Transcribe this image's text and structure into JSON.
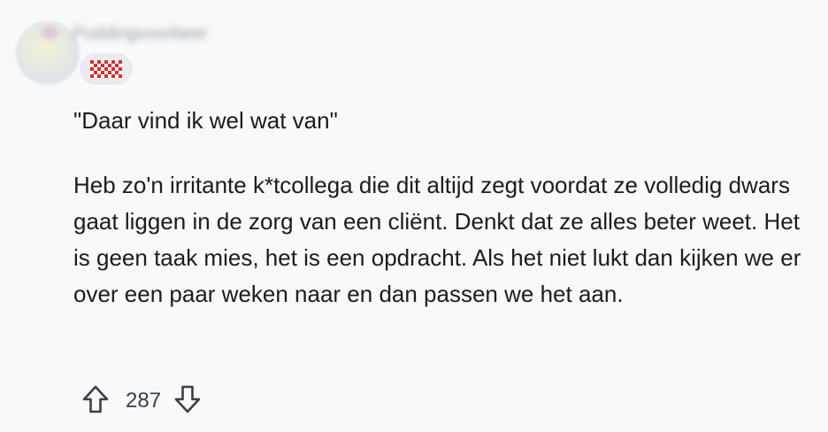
{
  "comment": {
    "author": "Puddingvoorbeer",
    "flair_icon": "checkered-flag-icon",
    "flair_colors": [
      "#e32b2b",
      "#ffffff"
    ],
    "paragraphs": [
      "\"Daar vind ik wel wat van\"",
      "Heb zo'n irritante k*tcollega die dit altijd zegt voordat ze volledig dwars gaat liggen in de zorg van een cliënt. Denkt dat ze alles beter weet. Het is geen taak mies, het is een opdracht. Als het niet lukt dan kijken we er over een paar weken naar en dan passen we het aan."
    ],
    "votes": {
      "score": "287",
      "upvote_icon": "arrow-up-icon",
      "downvote_icon": "arrow-down-icon"
    }
  }
}
